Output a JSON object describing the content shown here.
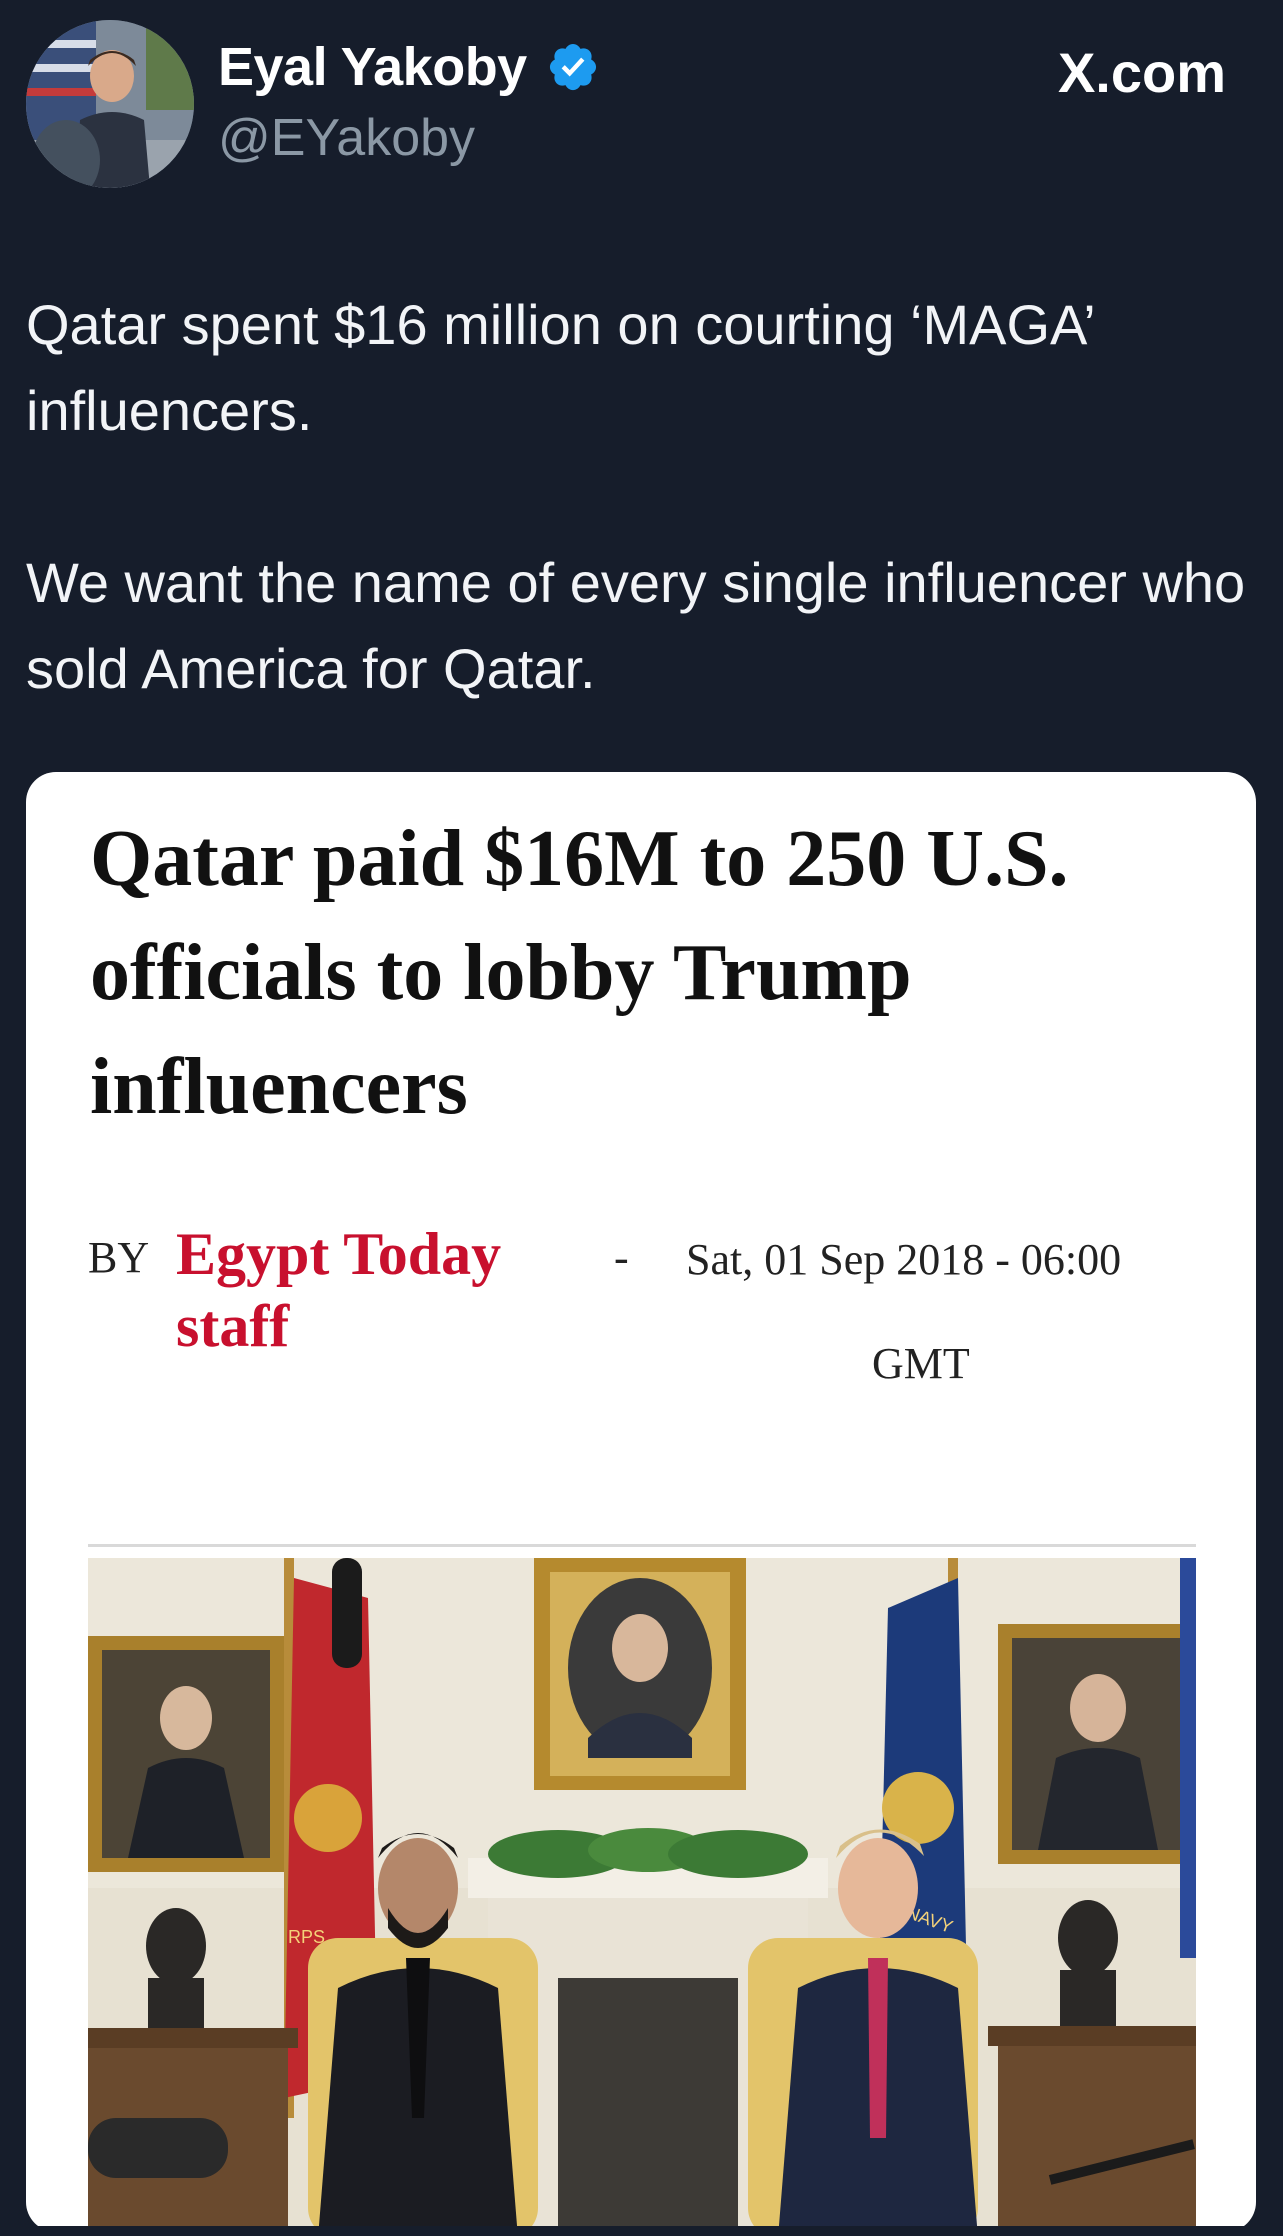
{
  "header": {
    "author_name": "Eyal Yakoby",
    "author_handle": "@EYakoby",
    "brand": "X.com"
  },
  "tweet": {
    "paragraph_1": "Qatar spent $16 million on courting ‘MAGA’ influencers.",
    "paragraph_2": "We want the name of every single influencer who sold America for Qatar."
  },
  "card": {
    "headline": "Qatar paid $16M to 250 U.S. officials to lobby Trump influencers",
    "byline_by": "BY",
    "byline_author": "Egypt Today staff",
    "byline_dash": "-",
    "byline_date": "Sat, 01 Sep 2018 - 06:00",
    "byline_tz": "GMT",
    "flag_text_1": "RPS",
    "flag_text_2": "S NAVY"
  },
  "colors": {
    "background": "#161d2b",
    "handle": "#8b98a5",
    "verified": "#1d9bf0",
    "byline_author": "#c8102e"
  }
}
